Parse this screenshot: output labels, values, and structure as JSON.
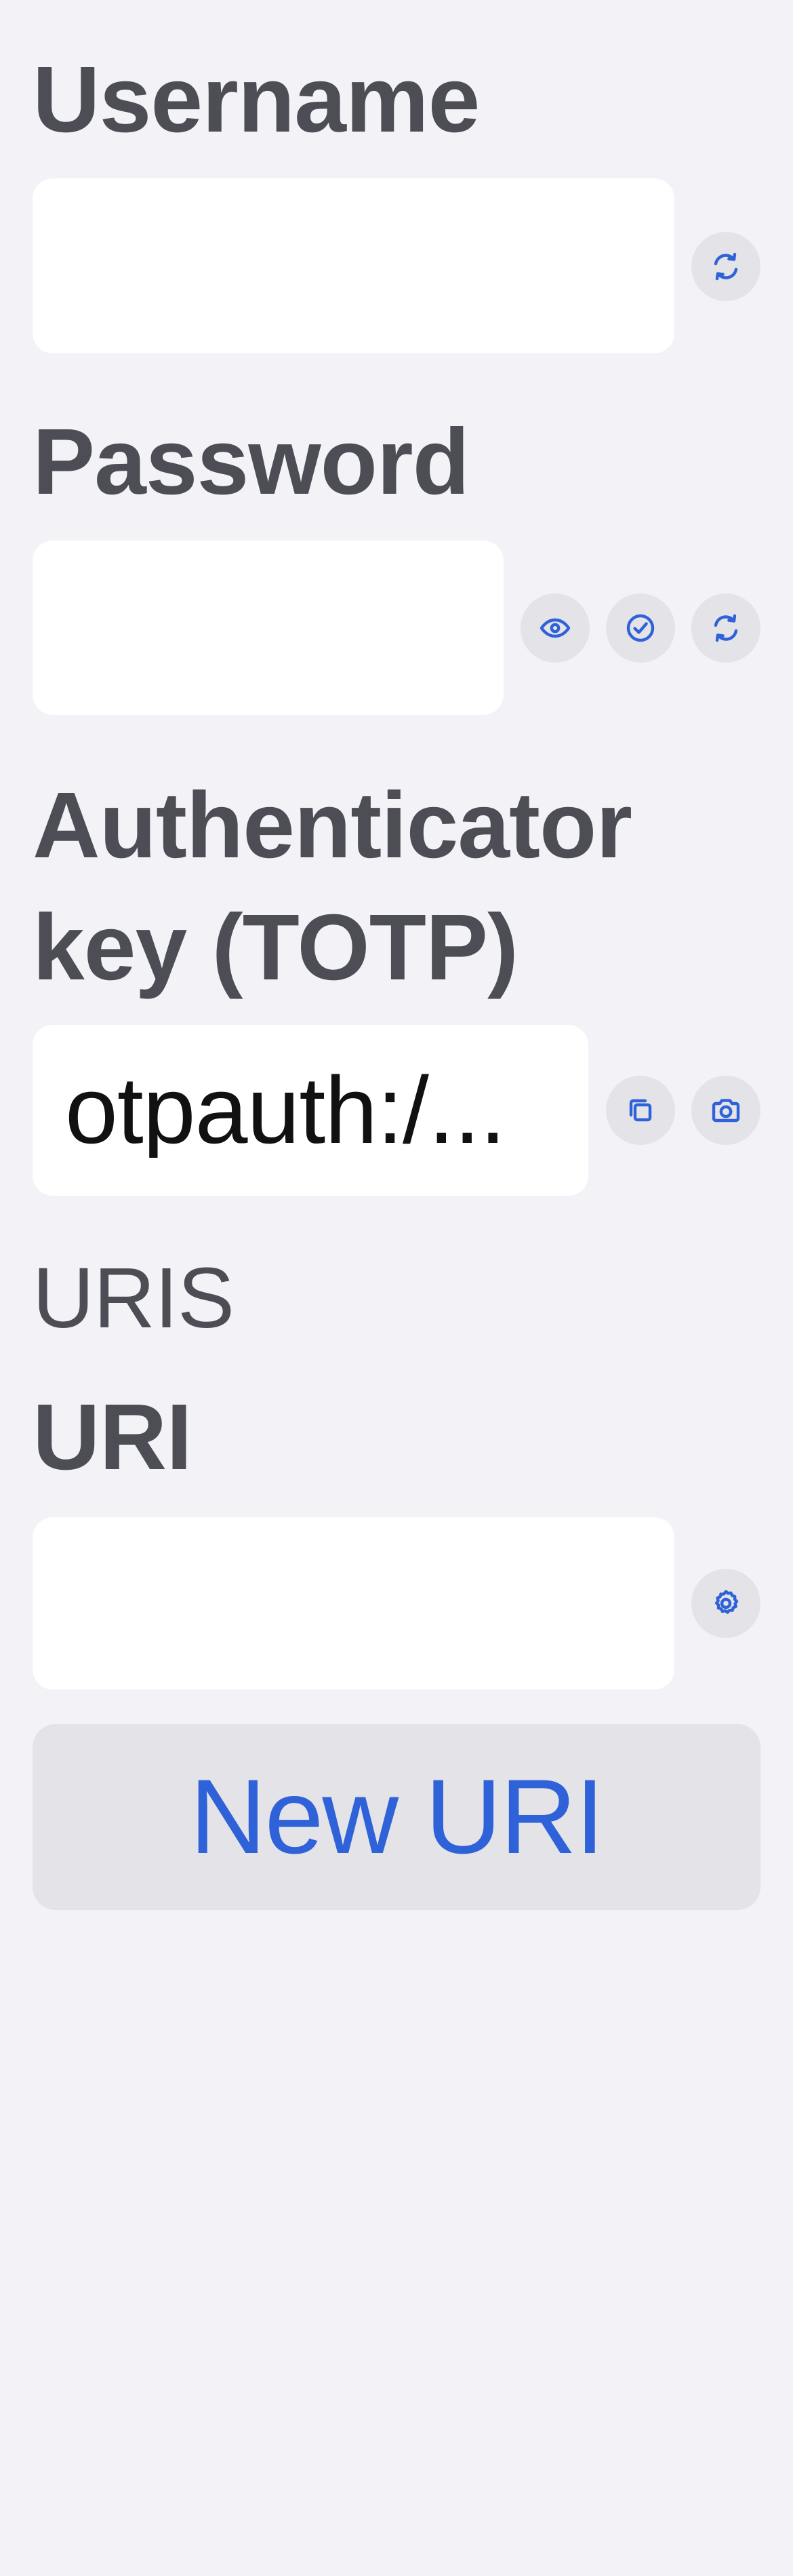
{
  "username": {
    "label": "Username",
    "value": ""
  },
  "password": {
    "label": "Password",
    "value": ""
  },
  "totp": {
    "label_line1": "Authenticator",
    "label_line2": "key (TOTP)",
    "value": "otpauth:/..."
  },
  "uris": {
    "section_header": "URIS",
    "uri_label": "URI",
    "uri_value": "",
    "new_uri_label": "New URI"
  },
  "icons": {
    "username_action": "refresh-icon",
    "password_reveal": "eye-icon",
    "password_check": "checkmark-circle-icon",
    "password_generate": "refresh-icon",
    "totp_copy": "copy-icon",
    "totp_scan": "camera-icon",
    "uri_options": "gear-icon"
  },
  "colors": {
    "background": "#f2f2f7",
    "field": "#ffffff",
    "label": "#4d4d55",
    "accent": "#2f62d8",
    "button_bg": "#e3e3e8"
  }
}
